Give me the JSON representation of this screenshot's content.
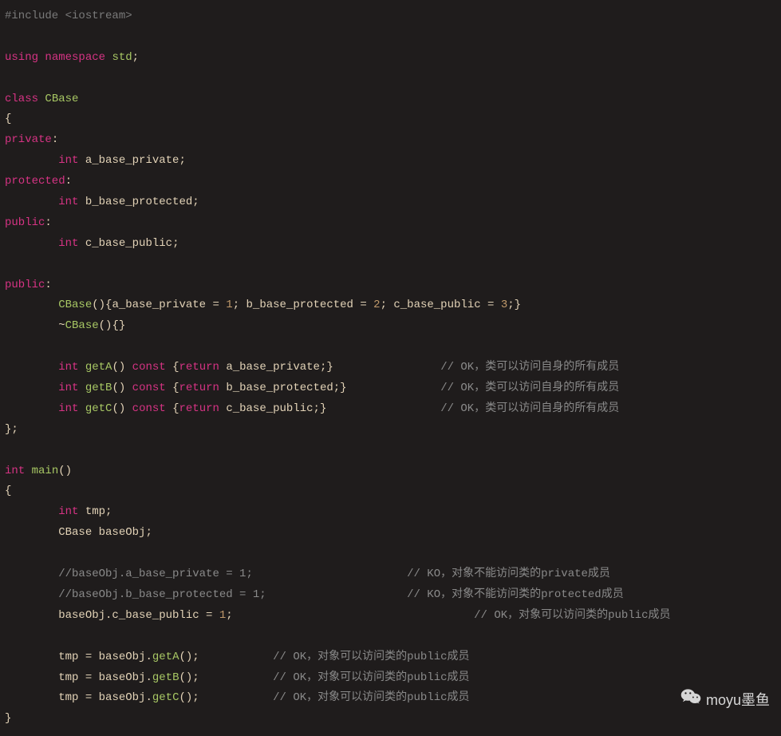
{
  "tokens": [
    [
      [
        "pp",
        "#include <iostream>"
      ]
    ],
    [],
    [
      [
        "kw",
        "using"
      ],
      [
        "pl",
        " "
      ],
      [
        "kw",
        "namespace"
      ],
      [
        "pl",
        " "
      ],
      [
        "func",
        "std"
      ],
      [
        "pun",
        ";"
      ]
    ],
    [],
    [
      [
        "kw",
        "class"
      ],
      [
        "pl",
        " "
      ],
      [
        "func",
        "CBase"
      ]
    ],
    [
      [
        "pun",
        "{"
      ]
    ],
    [
      [
        "kw",
        "private"
      ],
      [
        "pun",
        ":"
      ]
    ],
    [
      [
        "pl",
        "        "
      ],
      [
        "kw",
        "int"
      ],
      [
        "pl",
        " a_base_private"
      ],
      [
        "pun",
        ";"
      ]
    ],
    [
      [
        "kw",
        "protected"
      ],
      [
        "pun",
        ":"
      ]
    ],
    [
      [
        "pl",
        "        "
      ],
      [
        "kw",
        "int"
      ],
      [
        "pl",
        " b_base_protected"
      ],
      [
        "pun",
        ";"
      ]
    ],
    [
      [
        "kw",
        "public"
      ],
      [
        "pun",
        ":"
      ]
    ],
    [
      [
        "pl",
        "        "
      ],
      [
        "kw",
        "int"
      ],
      [
        "pl",
        " c_base_public"
      ],
      [
        "pun",
        ";"
      ]
    ],
    [],
    [
      [
        "kw",
        "public"
      ],
      [
        "pun",
        ":"
      ]
    ],
    [
      [
        "pl",
        "        "
      ],
      [
        "func",
        "CBase"
      ],
      [
        "pun",
        "(){"
      ],
      [
        "pl",
        "a_base_private "
      ],
      [
        "pun",
        "= "
      ],
      [
        "num",
        "1"
      ],
      [
        "pun",
        "; "
      ],
      [
        "pl",
        "b_base_protected "
      ],
      [
        "pun",
        "= "
      ],
      [
        "num",
        "2"
      ],
      [
        "pun",
        "; "
      ],
      [
        "pl",
        "c_base_public "
      ],
      [
        "pun",
        "= "
      ],
      [
        "num",
        "3"
      ],
      [
        "pun",
        ";}"
      ]
    ],
    [
      [
        "pl",
        "        ~"
      ],
      [
        "func",
        "CBase"
      ],
      [
        "pun",
        "(){}"
      ]
    ],
    [],
    [
      [
        "pl",
        "        "
      ],
      [
        "kw",
        "int"
      ],
      [
        "pl",
        " "
      ],
      [
        "func",
        "getA"
      ],
      [
        "pun",
        "() "
      ],
      [
        "kw",
        "const"
      ],
      [
        "pl",
        " "
      ],
      [
        "pun",
        "{"
      ],
      [
        "kw",
        "return"
      ],
      [
        "pl",
        " a_base_private"
      ],
      [
        "pun",
        ";}"
      ],
      [
        "pl",
        "                "
      ],
      [
        "cmt",
        "// OK，类可以访问自身的所有成员"
      ]
    ],
    [
      [
        "pl",
        "        "
      ],
      [
        "kw",
        "int"
      ],
      [
        "pl",
        " "
      ],
      [
        "func",
        "getB"
      ],
      [
        "pun",
        "() "
      ],
      [
        "kw",
        "const"
      ],
      [
        "pl",
        " "
      ],
      [
        "pun",
        "{"
      ],
      [
        "kw",
        "return"
      ],
      [
        "pl",
        " b_base_protected"
      ],
      [
        "pun",
        ";}"
      ],
      [
        "pl",
        "              "
      ],
      [
        "cmt",
        "// OK，类可以访问自身的所有成员"
      ]
    ],
    [
      [
        "pl",
        "        "
      ],
      [
        "kw",
        "int"
      ],
      [
        "pl",
        " "
      ],
      [
        "func",
        "getC"
      ],
      [
        "pun",
        "() "
      ],
      [
        "kw",
        "const"
      ],
      [
        "pl",
        " "
      ],
      [
        "pun",
        "{"
      ],
      [
        "kw",
        "return"
      ],
      [
        "pl",
        " c_base_public"
      ],
      [
        "pun",
        ";}"
      ],
      [
        "pl",
        "                 "
      ],
      [
        "cmt",
        "// OK，类可以访问自身的所有成员"
      ]
    ],
    [
      [
        "pun",
        "};"
      ]
    ],
    [],
    [
      [
        "kw",
        "int"
      ],
      [
        "pl",
        " "
      ],
      [
        "func",
        "main"
      ],
      [
        "pun",
        "()"
      ]
    ],
    [
      [
        "pun",
        "{"
      ]
    ],
    [
      [
        "pl",
        "        "
      ],
      [
        "kw",
        "int"
      ],
      [
        "pl",
        " tmp"
      ],
      [
        "pun",
        ";"
      ]
    ],
    [
      [
        "pl",
        "        CBase baseObj"
      ],
      [
        "pun",
        ";"
      ]
    ],
    [],
    [
      [
        "pl",
        "        "
      ],
      [
        "cmt",
        "//baseObj.a_base_private = 1;                       // KO，对象不能访问类的private成员"
      ]
    ],
    [
      [
        "pl",
        "        "
      ],
      [
        "cmt",
        "//baseObj.b_base_protected = 1;                     // KO，对象不能访问类的protected成员"
      ]
    ],
    [
      [
        "pl",
        "        baseObj.c_base_public "
      ],
      [
        "pun",
        "= "
      ],
      [
        "num",
        "1"
      ],
      [
        "pun",
        ";"
      ],
      [
        "pl",
        "                                    "
      ],
      [
        "cmt",
        "// OK，对象可以访问类的public成员"
      ]
    ],
    [],
    [
      [
        "pl",
        "        tmp "
      ],
      [
        "pun",
        "= "
      ],
      [
        "pl",
        "baseObj."
      ],
      [
        "func",
        "getA"
      ],
      [
        "pun",
        "();"
      ],
      [
        "pl",
        "           "
      ],
      [
        "cmt",
        "// OK，对象可以访问类的public成员"
      ]
    ],
    [
      [
        "pl",
        "        tmp "
      ],
      [
        "pun",
        "= "
      ],
      [
        "pl",
        "baseObj."
      ],
      [
        "func",
        "getB"
      ],
      [
        "pun",
        "();"
      ],
      [
        "pl",
        "           "
      ],
      [
        "cmt",
        "// OK，对象可以访问类的public成员"
      ]
    ],
    [
      [
        "pl",
        "        tmp "
      ],
      [
        "pun",
        "= "
      ],
      [
        "pl",
        "baseObj."
      ],
      [
        "func",
        "getC"
      ],
      [
        "pun",
        "();"
      ],
      [
        "pl",
        "           "
      ],
      [
        "cmt",
        "// OK，对象可以访问类的public成员"
      ]
    ],
    [
      [
        "pun",
        "}"
      ]
    ]
  ],
  "watermark": {
    "label": "moyu墨鱼"
  }
}
